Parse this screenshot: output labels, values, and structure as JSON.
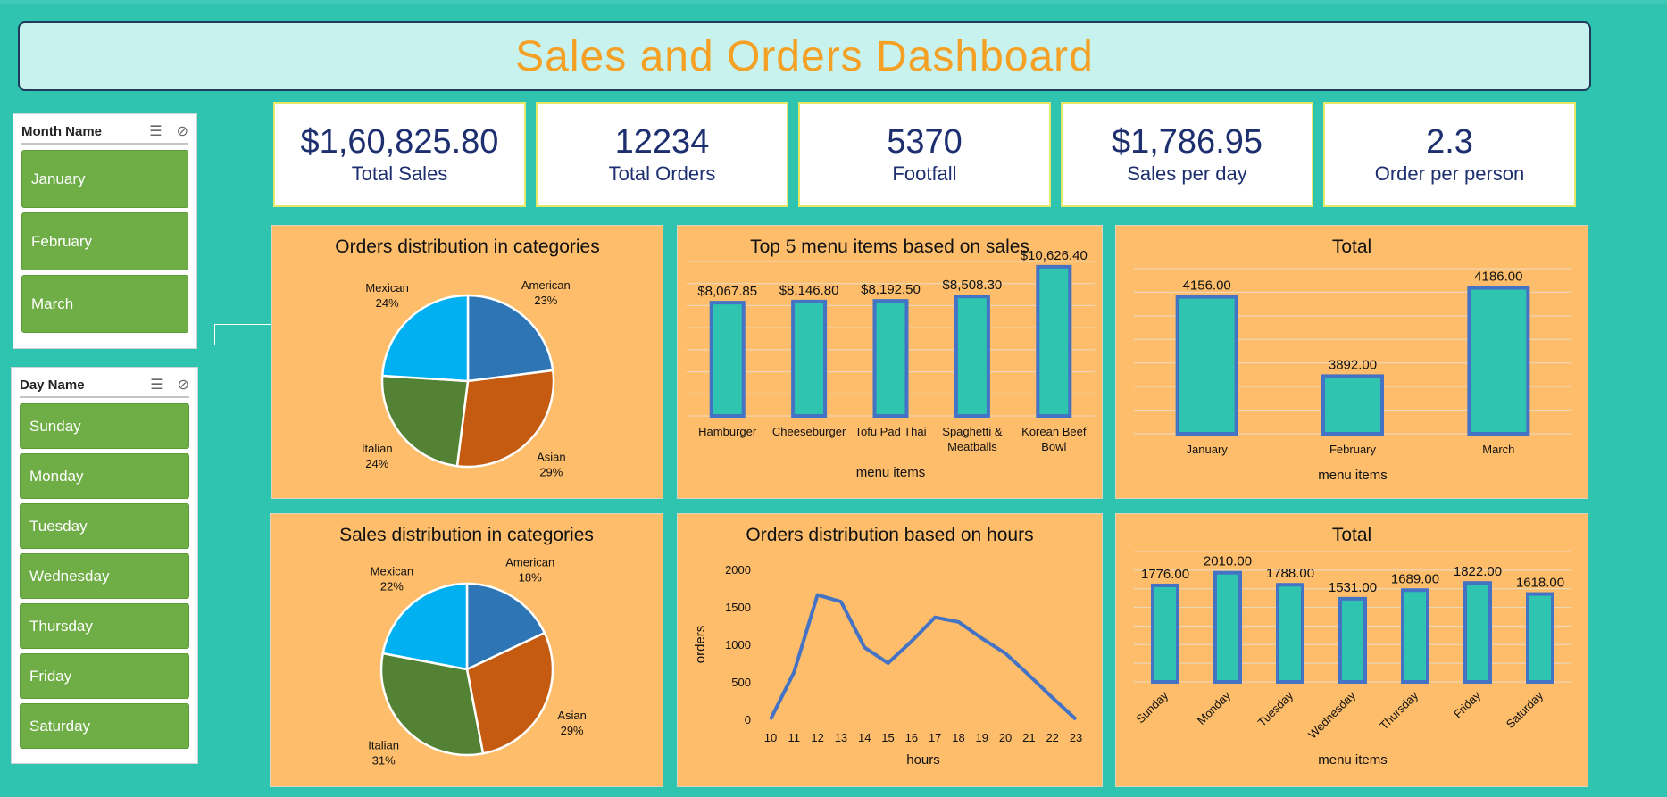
{
  "dashboard": {
    "title": "Sales and Orders Dashboard"
  },
  "slicers": {
    "month": {
      "title": "Month Name",
      "items": [
        "January",
        "February",
        "March"
      ]
    },
    "day": {
      "title": "Day Name",
      "items": [
        "Sunday",
        "Monday",
        "Tuesday",
        "Wednesday",
        "Thursday",
        "Friday",
        "Saturday"
      ]
    },
    "tools": {
      "multiselect_icon": "multi-select-icon",
      "clear_icon": "clear-filter-icon"
    }
  },
  "kpis": [
    {
      "value": "$1,60,825.80",
      "label": "Total Sales"
    },
    {
      "value": "12234",
      "label": "Total Orders"
    },
    {
      "value": "5370",
      "label": "Footfall"
    },
    {
      "value": "$1,786.95",
      "label": "Sales per day"
    },
    {
      "value": "2.3",
      "label": "Order per person"
    }
  ],
  "colors": {
    "background": "#2ec4b0",
    "panel": "#fdbd6a",
    "bar_fill": "#2ec4b0",
    "bar_border": "#4472c4",
    "line": "#4472c4",
    "title": "#f3a024",
    "kpi_text": "#1d2f6f",
    "slicer_button": "#6fad46",
    "american": "#2e75b6",
    "asian": "#c55a11",
    "italian": "#548235",
    "mexican": "#00b0f0"
  },
  "chart_data": [
    {
      "id": "orders_pie",
      "type": "pie",
      "title": "Orders distribution in categories",
      "slices": [
        {
          "name": "American",
          "value": 23,
          "label": "23%"
        },
        {
          "name": "Asian",
          "value": 29,
          "label": "29%"
        },
        {
          "name": "Italian",
          "value": 24,
          "label": "24%"
        },
        {
          "name": "Mexican",
          "value": 24,
          "label": "24%"
        }
      ]
    },
    {
      "id": "top5_bar",
      "type": "bar",
      "title": "Top 5 menu items based on sales",
      "categories": [
        [
          "Hamburger"
        ],
        [
          "Cheeseburger"
        ],
        [
          "Tofu Pad Thai"
        ],
        [
          "Spaghetti &",
          "Meatballs"
        ],
        [
          "Korean Beef",
          "Bowl"
        ]
      ],
      "values": [
        8067.85,
        8146.8,
        8192.5,
        8508.3,
        10626.4
      ],
      "value_labels": [
        "$8,067.85",
        "$8,146.80",
        "$8,192.50",
        "$8,508.30",
        "$10,626.40"
      ],
      "xlabel": "menu items",
      "ylim": [
        0,
        11000
      ],
      "grid": true
    },
    {
      "id": "month_bar",
      "type": "bar",
      "title": "Total",
      "categories": [
        [
          "January"
        ],
        [
          "February"
        ],
        [
          "March"
        ]
      ],
      "values": [
        4156,
        3892,
        4186
      ],
      "value_labels": [
        "4156.00",
        "3892.00",
        "4186.00"
      ],
      "xlabel": "menu items",
      "ylim": [
        3700,
        4250
      ],
      "grid": true
    },
    {
      "id": "sales_pie",
      "type": "pie",
      "title": "Sales distribution in categories",
      "slices": [
        {
          "name": "American",
          "value": 18,
          "label": "18%"
        },
        {
          "name": "Asian",
          "value": 29,
          "label": "29%"
        },
        {
          "name": "Italian",
          "value": 31,
          "label": "31%"
        },
        {
          "name": "Mexican",
          "value": 22,
          "label": "22%"
        }
      ]
    },
    {
      "id": "hours_line",
      "type": "line",
      "title": "Orders distribution based on hours",
      "x": [
        10,
        11,
        12,
        13,
        14,
        15,
        16,
        17,
        18,
        19,
        20,
        21,
        22,
        23
      ],
      "y": [
        0,
        630,
        1660,
        1570,
        960,
        750,
        1040,
        1360,
        1300,
        1080,
        880,
        590,
        290,
        0
      ],
      "xlabel": "hours",
      "ylabel": "orders",
      "ylim": [
        0,
        2000
      ],
      "yticks": [
        0,
        500,
        1000,
        1500,
        2000
      ],
      "grid": false
    },
    {
      "id": "day_bar",
      "type": "bar",
      "title": "Total",
      "categories": [
        [
          "Sunday"
        ],
        [
          "Monday"
        ],
        [
          "Tuesday"
        ],
        [
          "Wednesday"
        ],
        [
          "Thursday"
        ],
        [
          "Friday"
        ],
        [
          "Saturday"
        ]
      ],
      "values": [
        1776,
        2010,
        1788,
        1531,
        1689,
        1822,
        1618
      ],
      "value_labels": [
        "1776.00",
        "2010.00",
        "1788.00",
        "1531.00",
        "1689.00",
        "1822.00",
        "1618.00"
      ],
      "xlabel": "menu items",
      "ylim": [
        0,
        2400
      ],
      "grid": true,
      "rotate_labels": true
    }
  ]
}
